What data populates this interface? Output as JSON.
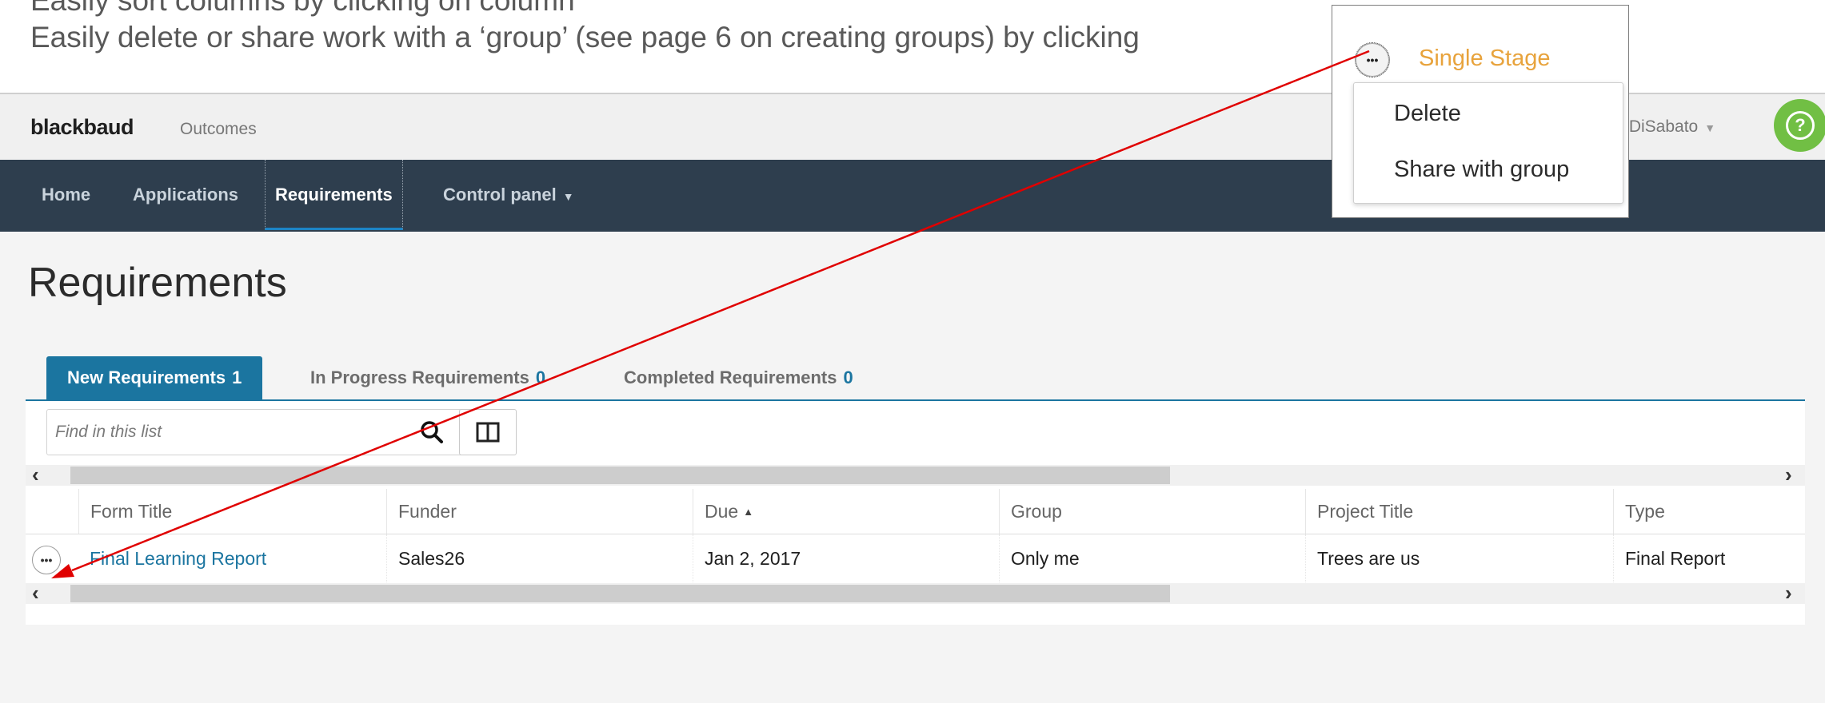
{
  "captions": {
    "line1": "Easily sort columns by clicking on column",
    "line2": "Easily delete or share work with a ‘group’ (see page 6 on creating groups) by clicking"
  },
  "header": {
    "logo": "blackbaud",
    "product": "Outcomes",
    "user_name": "lle DiSabato",
    "help_icon": "question-circle-icon",
    "help_glyph": "?"
  },
  "nav": {
    "items": [
      {
        "label": "Home"
      },
      {
        "label": "Applications"
      },
      {
        "label": "Requirements",
        "active": true
      },
      {
        "label": "Control panel"
      }
    ]
  },
  "page": {
    "title": "Requirements"
  },
  "tabs": [
    {
      "label": "New Requirements",
      "count": "1",
      "active": true
    },
    {
      "label": "In Progress Requirements",
      "count": "0"
    },
    {
      "label": "Completed Requirements",
      "count": "0"
    }
  ],
  "search": {
    "placeholder": "Find in this list",
    "value": ""
  },
  "grid": {
    "columns": [
      "Form Title",
      "Funder",
      "Due",
      "Group",
      "Project Title",
      "Type"
    ],
    "sort_column": "Due",
    "sort_direction": "ascending",
    "rows": [
      {
        "form_title": "Final Learning Report",
        "funder": "Sales26",
        "due": "Jan 2, 2017",
        "group": "Only me",
        "project_title": "Trees are us",
        "type": "Final Report"
      }
    ]
  },
  "context_popup": {
    "stage_label": "Single Stage",
    "menu": [
      "Delete",
      "Share with group"
    ]
  },
  "colors": {
    "nav_bg": "#2e3e4e",
    "accent": "#1b75a0",
    "stage": "#e8a33c",
    "help": "#71bf44",
    "annotation_arrow": "#e00000"
  }
}
